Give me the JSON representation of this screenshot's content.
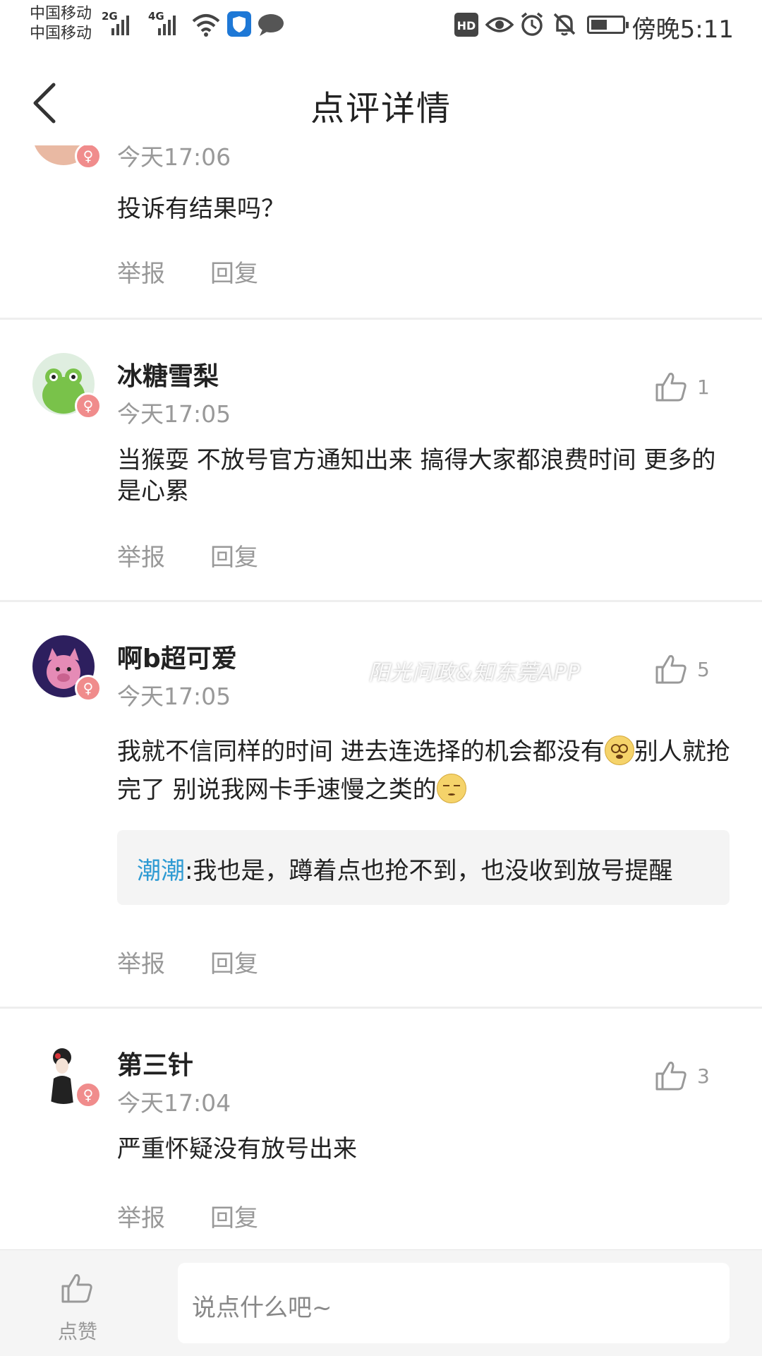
{
  "status_bar": {
    "carrier_1": "中国移动",
    "carrier_2": "中国移动",
    "net_1": "2G",
    "net_2": "4G",
    "hd_label": "HD",
    "time": "傍晚5:11"
  },
  "header": {
    "title": "点评详情"
  },
  "comments": [
    {
      "time": "今天17:06",
      "text": "投诉有结果吗？",
      "report_label": "举报",
      "reply_label": "回复"
    },
    {
      "name": "冰糖雪梨",
      "time": "今天17:05",
      "likes": "1",
      "text": "当猴耍 不放号官方通知出来  搞得大家都浪费时间 更多的是心累",
      "report_label": "举报",
      "reply_label": "回复"
    },
    {
      "name": "啊b超可爱",
      "time": "今天17:05",
      "likes": "5",
      "text_part1": "我就不信同样的时间 进去连选择的机会都没有",
      "text_part2": "别人就抢完了 别说我网卡手速慢之类的",
      "reply_name": "潮潮",
      "reply_text": ":我也是，蹲着点也抢不到，也没收到放号提醒",
      "report_label": "举报",
      "reply_label": "回复"
    },
    {
      "name": "第三针",
      "time": "今天17:04",
      "likes": "3",
      "text": "严重怀疑没有放号出来",
      "report_label": "举报",
      "reply_label": "回复"
    }
  ],
  "watermark": "阳光问政&知东莞APP",
  "bottom_bar": {
    "like_label": "点赞",
    "input_placeholder": "说点什么吧~"
  },
  "icons": {
    "back": "chevron-left-icon",
    "like": "thumbs-up-icon",
    "gender": "female-icon"
  },
  "colors": {
    "reply_name": "#2f9bd3",
    "secondary_text": "#999999",
    "gender_badge": "#f08c8c"
  }
}
